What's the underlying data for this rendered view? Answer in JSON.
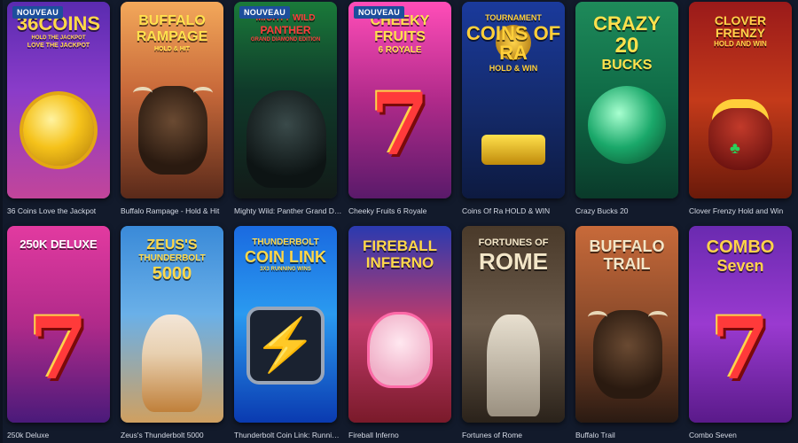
{
  "badge_label": "NOUVEAU",
  "games": [
    {
      "caption": "36 Coins Love the Jackpot",
      "art_lines": [
        "36COINS",
        "HOLD THE JACKPOT",
        "LOVE THE JACKPOT"
      ],
      "new": true,
      "theme": "purple"
    },
    {
      "caption": "Buffalo Rampage - Hold & Hit",
      "art_lines": [
        "BUFFALO",
        "RAMPAGE",
        "HOLD & HIT"
      ],
      "new": false,
      "theme": "desert"
    },
    {
      "caption": "Mighty Wild: Panther Grand Diamo...",
      "art_lines": [
        "MIGHTY WILD",
        "PANTHER",
        "GRAND DIAMOND EDITION"
      ],
      "new": true,
      "theme": "jungle"
    },
    {
      "caption": "Cheeky Fruits 6 Royale",
      "art_lines": [
        "CHEEKY",
        "FRUITS",
        "6 ROYALE"
      ],
      "new": true,
      "theme": "pink"
    },
    {
      "caption": "Coins Of Ra HOLD & WIN",
      "art_lines": [
        "TOURNAMENT",
        "COINS OF RA",
        "HOLD & WIN"
      ],
      "new": false,
      "theme": "egypt"
    },
    {
      "caption": "Crazy Bucks 20",
      "art_lines": [
        "CRAZY",
        "20",
        "BUCKS"
      ],
      "new": false,
      "theme": "green"
    },
    {
      "caption": "Clover Frenzy Hold and Win",
      "art_lines": [
        "CLOVER FRENZY",
        "HOLD AND WIN"
      ],
      "new": false,
      "theme": "clover"
    },
    {
      "caption": "250k Deluxe",
      "art_lines": [
        "250K DELUXE"
      ],
      "new": false,
      "theme": "pink7"
    },
    {
      "caption": "Zeus's Thunderbolt 5000",
      "art_lines": [
        "ZEUS'S",
        "THUNDERBOLT",
        "5000"
      ],
      "new": false,
      "theme": "sky"
    },
    {
      "caption": "Thunderbolt Coin Link: Running Wins",
      "art_lines": [
        "THUNDERBOLT",
        "COIN LINK",
        "3X3 RUNNING WINS"
      ],
      "new": false,
      "theme": "blue"
    },
    {
      "caption": "Fireball Inferno",
      "art_lines": [
        "FIREBALL",
        "INFERNO"
      ],
      "new": false,
      "theme": "fire"
    },
    {
      "caption": "Fortunes of Rome",
      "art_lines": [
        "FORTUNES OF",
        "ROME"
      ],
      "new": false,
      "theme": "rome"
    },
    {
      "caption": "Buffalo Trail",
      "art_lines": [
        "BUFFALO",
        "TRAIL"
      ],
      "new": false,
      "theme": "trail"
    },
    {
      "caption": "Combo Seven",
      "art_lines": [
        "COMBO",
        "Seven"
      ],
      "new": false,
      "theme": "combo"
    }
  ]
}
